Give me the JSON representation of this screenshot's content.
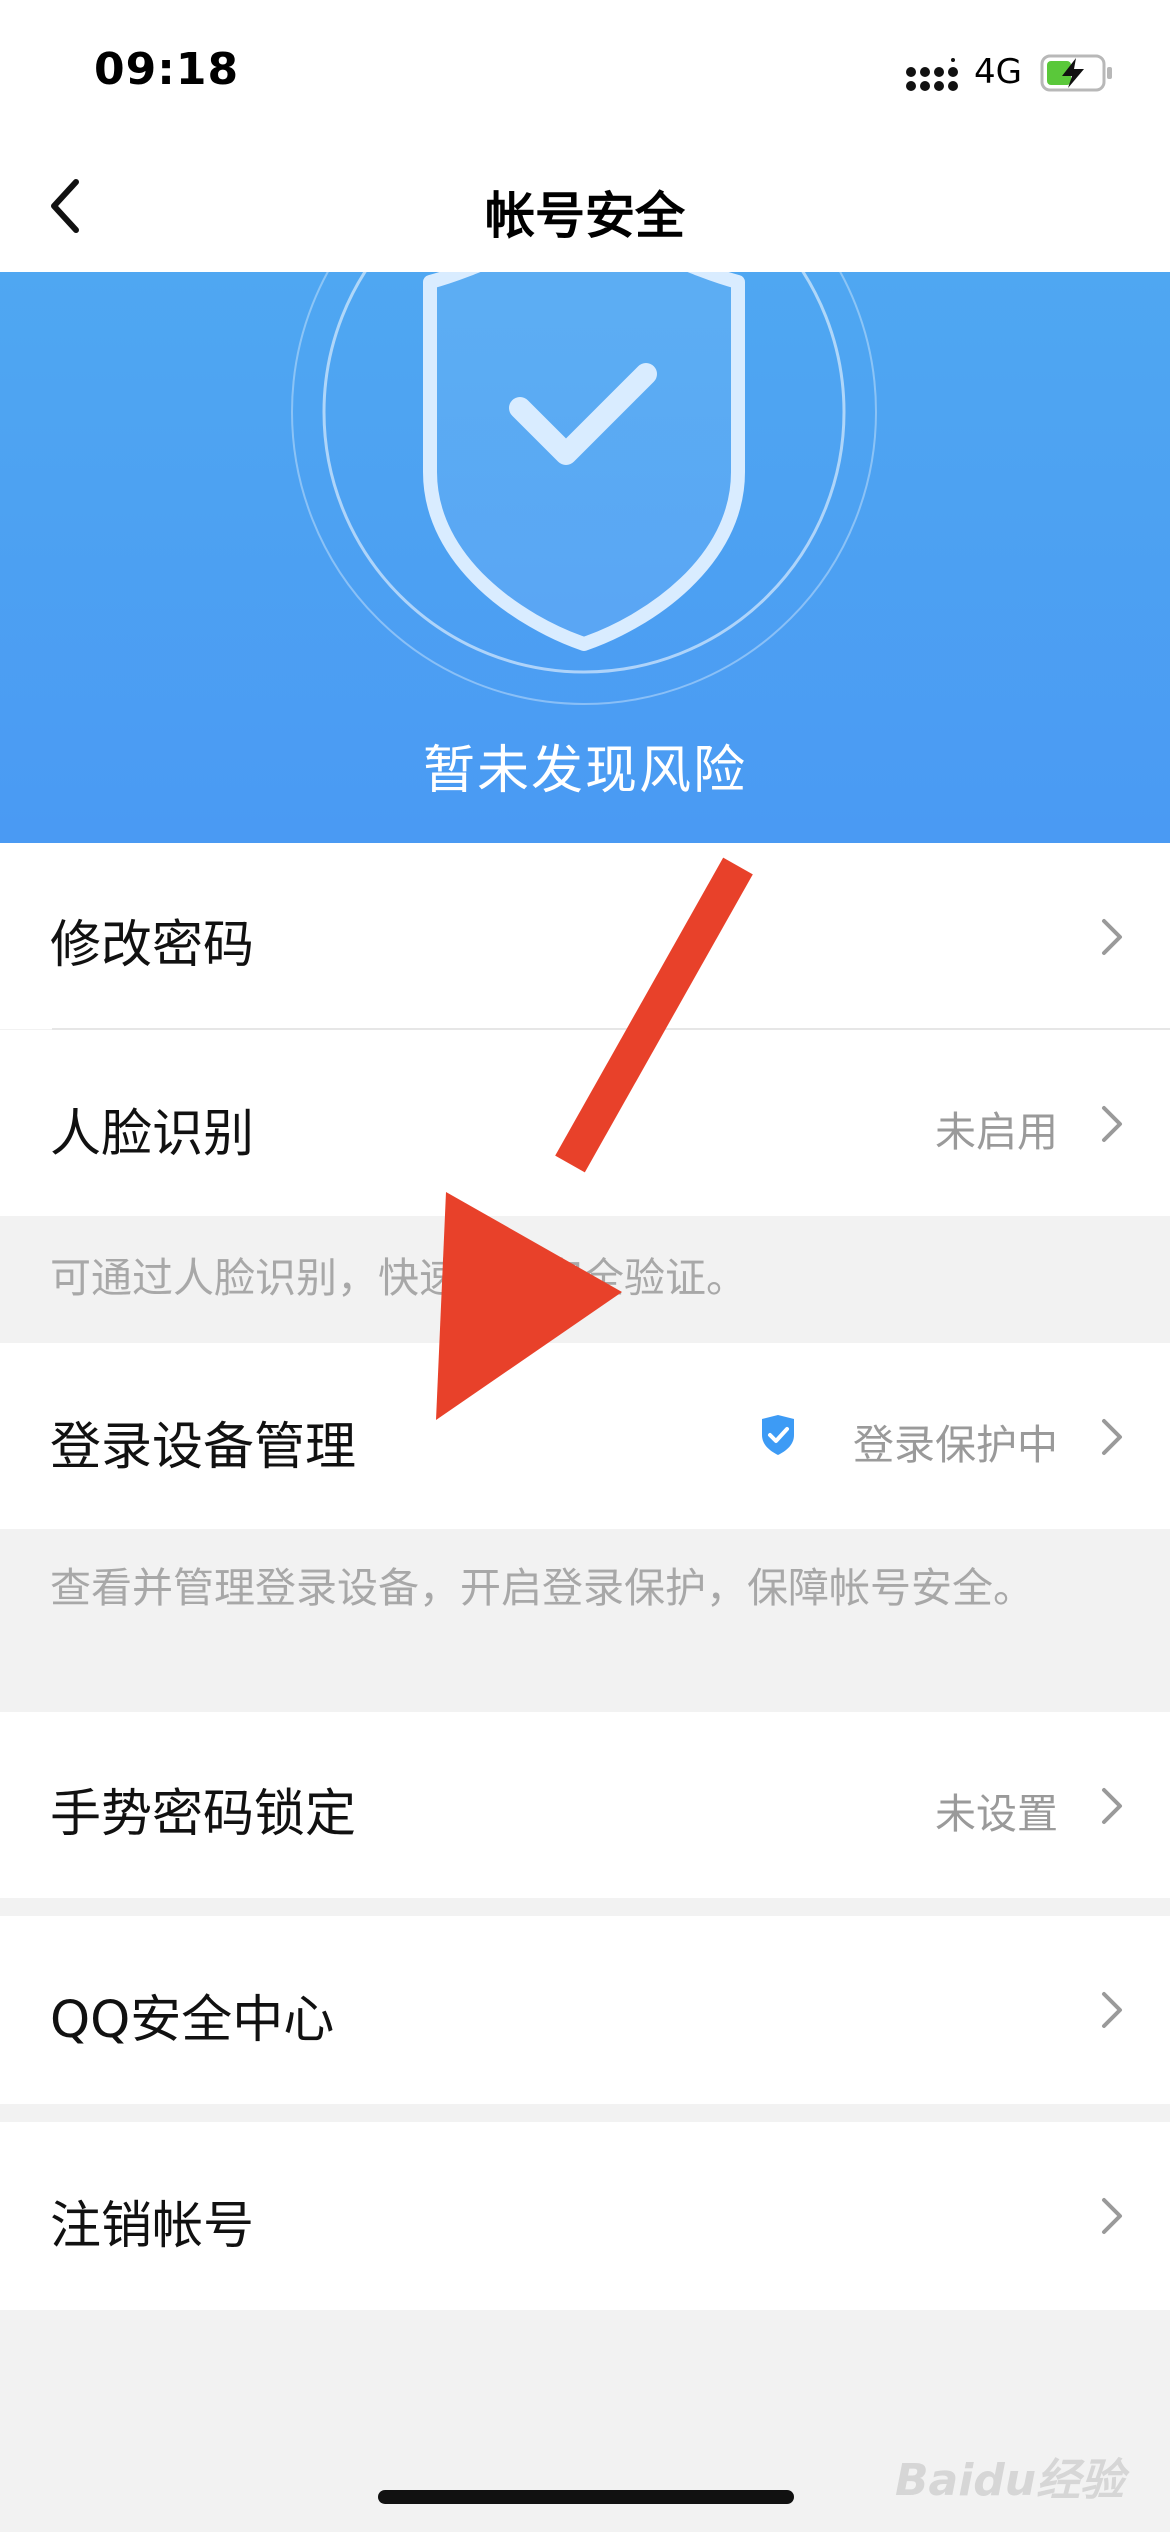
{
  "status_bar": {
    "time": "09:18",
    "network": "4G"
  },
  "nav": {
    "title": "帐号安全"
  },
  "hero": {
    "status_text": "暂未发现风险"
  },
  "items": [
    {
      "label": "修改密码",
      "value": ""
    },
    {
      "label": "人脸识别",
      "value": "未启用"
    },
    {
      "label": "登录设备管理",
      "value": "登录保护中"
    },
    {
      "label": "手势密码锁定",
      "value": "未设置"
    },
    {
      "label": "QQ安全中心",
      "value": ""
    },
    {
      "label": "注销帐号",
      "value": ""
    }
  ],
  "notes": {
    "face": "可通过人脸识别，快速进行安全验证。",
    "device": "查看并管理登录设备，开启登录保护，保障帐号安全。"
  },
  "watermark": "Baidu经验",
  "colors": {
    "hero": "#4a9ef3",
    "arrow": "#e8412a",
    "badge": "#3d9bf5"
  }
}
